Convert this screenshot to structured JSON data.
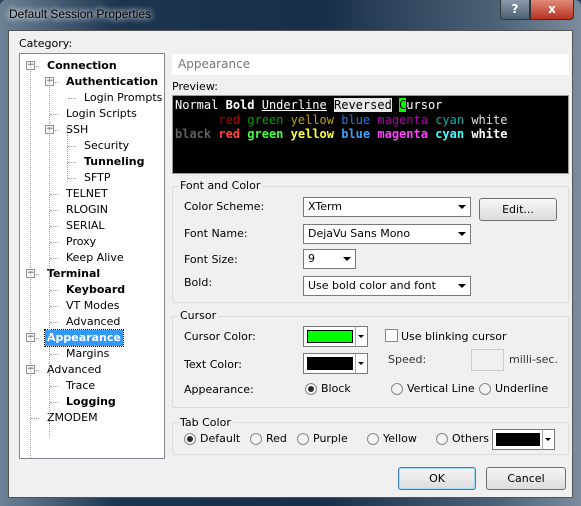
{
  "window": {
    "title": "Default Session Properties",
    "help_label": "?",
    "close_label": "x"
  },
  "category_label": "Category:",
  "tree": [
    {
      "label": "Connection",
      "level": 0,
      "bold": true,
      "expander": "−"
    },
    {
      "label": "Authentication",
      "level": 1,
      "bold": true,
      "expander": "−"
    },
    {
      "label": "Login Prompts",
      "level": 2
    },
    {
      "label": "Login Scripts",
      "level": 1
    },
    {
      "label": "SSH",
      "level": 1,
      "expander": "−"
    },
    {
      "label": "Security",
      "level": 2
    },
    {
      "label": "Tunneling",
      "level": 2,
      "bold": true
    },
    {
      "label": "SFTP",
      "level": 2
    },
    {
      "label": "TELNET",
      "level": 1
    },
    {
      "label": "RLOGIN",
      "level": 1
    },
    {
      "label": "SERIAL",
      "level": 1
    },
    {
      "label": "Proxy",
      "level": 1
    },
    {
      "label": "Keep Alive",
      "level": 1
    },
    {
      "label": "Terminal",
      "level": 0,
      "bold": true,
      "expander": "−"
    },
    {
      "label": "Keyboard",
      "level": 1,
      "bold": true
    },
    {
      "label": "VT Modes",
      "level": 1
    },
    {
      "label": "Advanced",
      "level": 1
    },
    {
      "label": "Appearance",
      "level": 0,
      "bold": true,
      "expander": "−",
      "selected": true
    },
    {
      "label": "Margins",
      "level": 1
    },
    {
      "label": "Advanced",
      "level": 0,
      "expander": "−"
    },
    {
      "label": "Trace",
      "level": 1
    },
    {
      "label": "Logging",
      "level": 1,
      "bold": true
    },
    {
      "label": "ZMODEM",
      "level": 0
    }
  ],
  "panel": {
    "header": "Appearance",
    "preview_label": "Preview:"
  },
  "preview": {
    "line1": {
      "normal": "Normal",
      "bold": "Bold",
      "underline": "Underline",
      "reversed": "Reversed",
      "cursor_char": "C",
      "cursor_rest": "ursor"
    },
    "normal_colors": [
      {
        "t": "red",
        "c": "#c00000"
      },
      {
        "t": "green",
        "c": "#00a000"
      },
      {
        "t": "yellow",
        "c": "#c0a000"
      },
      {
        "t": "blue",
        "c": "#2878e0"
      },
      {
        "t": "magenta",
        "c": "#b000b0"
      },
      {
        "t": "cyan",
        "c": "#00b0b0"
      },
      {
        "t": "white",
        "c": "#e0e0e0"
      }
    ],
    "black_label": "black",
    "black_color": "#606060",
    "bold_colors": [
      {
        "t": "red",
        "c": "#ff4040"
      },
      {
        "t": "green",
        "c": "#40ff40"
      },
      {
        "t": "yellow",
        "c": "#ffff40"
      },
      {
        "t": "blue",
        "c": "#40a0ff"
      },
      {
        "t": "magenta",
        "c": "#ff40ff"
      },
      {
        "t": "cyan",
        "c": "#40ffff"
      },
      {
        "t": "white",
        "c": "#ffffff"
      }
    ]
  },
  "font_color": {
    "title": "Font and Color",
    "scheme_label": "Color Scheme:",
    "scheme": "XTerm",
    "edit": "Edit...",
    "font_label": "Font Name:",
    "font": "DejaVu Sans Mono",
    "size_label": "Font Size:",
    "size": "9",
    "bold_label": "Bold:",
    "bold": "Use bold color and font"
  },
  "cursor": {
    "title": "Cursor",
    "color_label": "Cursor Color:",
    "cursor_color": "#00ff00",
    "blink_label": "Use blinking cursor",
    "blink_checked": false,
    "text_color_label": "Text Color:",
    "text_color": "#000000",
    "speed_label": "Speed:",
    "speed": "",
    "speed_unit": "milli-sec.",
    "appearance_label": "Appearance:",
    "options": [
      "Block",
      "Vertical Line",
      "Underline"
    ],
    "selected": "Block"
  },
  "tab_color": {
    "title": "Tab Color",
    "options": [
      "Default",
      "Red",
      "Purple",
      "Yellow",
      "Others"
    ],
    "selected": "Default",
    "others_color": "#000000"
  },
  "buttons": {
    "ok": "OK",
    "cancel": "Cancel"
  }
}
